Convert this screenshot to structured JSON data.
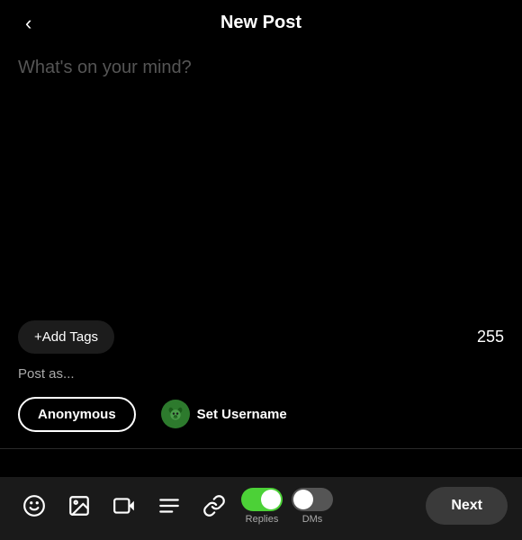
{
  "header": {
    "title": "New Post",
    "back_label": "‹"
  },
  "textarea": {
    "placeholder": "What's on your mind?"
  },
  "tags": {
    "add_label": "+Add Tags",
    "char_count": "255"
  },
  "post_as": {
    "label": "Post as...",
    "anonymous_label": "Anonymous",
    "username_label": "Set Username"
  },
  "toolbar": {
    "emoji_icon": "emoji",
    "image_icon": "image",
    "video_icon": "video",
    "text_icon": "text",
    "link_icon": "link",
    "replies_label": "Replies",
    "dms_label": "DMs",
    "next_label": "Next"
  },
  "toggles": {
    "replies_on": true,
    "dms_off": false
  }
}
